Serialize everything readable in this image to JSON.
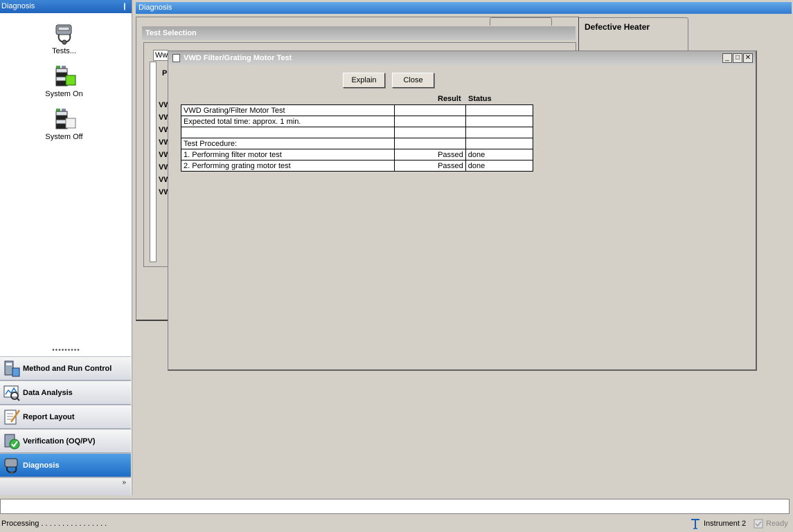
{
  "left_panel": {
    "header": "Diagnosis",
    "pin_icon": "❙",
    "tools": [
      {
        "label": "Tests...",
        "icon": "stethoscope-icon"
      },
      {
        "label": "System On",
        "icon": "instrument-stack-on-icon"
      },
      {
        "label": "System Off",
        "icon": "instrument-stack-off-icon"
      }
    ],
    "splitter": "•••••••••",
    "nav": [
      {
        "label": "Method and Run Control",
        "active": false
      },
      {
        "label": "Data Analysis",
        "active": false
      },
      {
        "label": "Report Layout",
        "active": false
      },
      {
        "label": "Verification (OQ/PV)",
        "active": false
      },
      {
        "label": "Diagnosis",
        "active": true
      }
    ],
    "more_chevron": "»"
  },
  "right_header": "Diagnosis",
  "background": {
    "window_title": "Test Selection",
    "tab_label": "Defective Heater",
    "partial_text": "Ww",
    "partial_p": "P",
    "row_stub": "VW"
  },
  "dialog": {
    "title": "VWD Filter/Grating Motor Test",
    "controls": {
      "minimize": "_",
      "maximize": "□",
      "close": "✕"
    },
    "explain_label": "Explain",
    "close_label": "Close",
    "col_result": "Result",
    "col_status": "Status",
    "rows": [
      {
        "step": "VWD Grating/Filter Motor Test",
        "result": "",
        "status": ""
      },
      {
        "step": "Expected total time: approx. 1 min.",
        "result": "",
        "status": ""
      },
      {
        "step": "",
        "result": "",
        "status": ""
      },
      {
        "step": "Test Procedure:",
        "result": "",
        "status": ""
      },
      {
        "step": "1. Performing filter motor test",
        "result": "Passed",
        "status": "done"
      },
      {
        "step": "2. Performing grating motor test",
        "result": "Passed",
        "status": "done"
      }
    ]
  },
  "status_bar": {
    "left": "Processing . . . . . . . . . . . . . . . .",
    "instrument": "Instrument 2",
    "ready": "Ready"
  }
}
